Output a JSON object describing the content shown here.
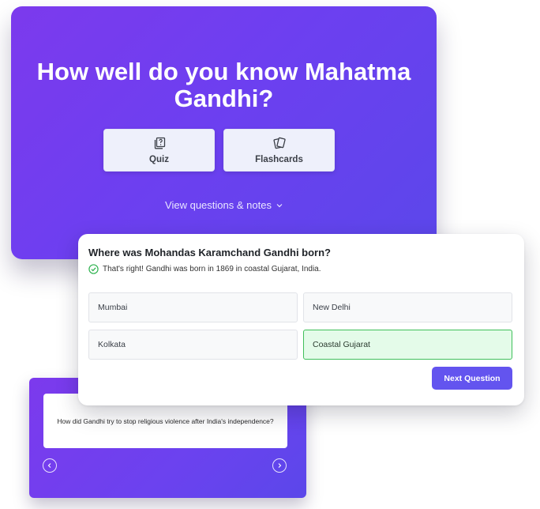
{
  "hero": {
    "title": "How well do you know Mahatma Gandhi?",
    "modes": [
      {
        "label": "Quiz",
        "icon": "quiz-cards-icon"
      },
      {
        "label": "Flashcards",
        "icon": "flashcards-icon"
      }
    ],
    "view_link": "View questions & notes",
    "view_link_icon": "chevron-down-icon"
  },
  "question": {
    "text": "Where was Mohandas Karamchand Gandhi born?",
    "feedback": "That's right! Gandhi was born in 1869 in coastal Gujarat, India.",
    "feedback_icon": "check-circle-icon",
    "options": [
      "Mumbai",
      "New Delhi",
      "Kolkata",
      "Coastal Gujarat"
    ],
    "selected_option": "Coastal Gujarat",
    "next_label": "Next Question"
  },
  "flashcard": {
    "text": "How did Gandhi try to stop religious violence after India's independence?",
    "prev_icon": "chevron-left-icon",
    "next_icon": "chevron-right-icon"
  },
  "colors": {
    "hero_gradient_start": "#7c3aed",
    "hero_gradient_end": "#5b47ea",
    "correct_bg": "#e4fbe9",
    "correct_border": "#3fbf5a",
    "primary_button": "#6354ef"
  }
}
